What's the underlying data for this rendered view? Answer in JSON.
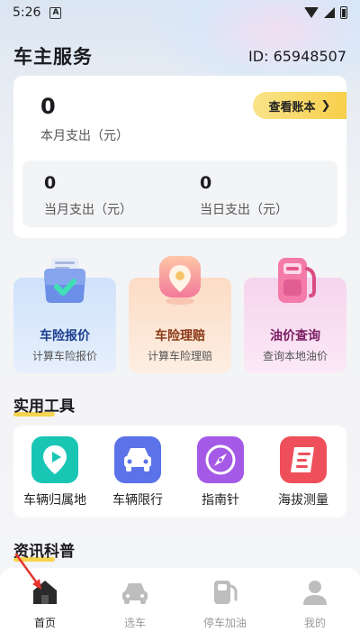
{
  "status_bar": {
    "time": "5:26",
    "a_icon": "A"
  },
  "header": {
    "title": "车主服务",
    "user_id": "ID: 65948507"
  },
  "summary": {
    "month_value": "0",
    "month_label": "本月支出（元）",
    "ledger_button": "查看账本",
    "current_month_value": "0",
    "current_month_label": "当月支出（元）",
    "today_value": "0",
    "today_label": "当日支出（元）"
  },
  "service_tiles": [
    {
      "title": "车险报价",
      "subtitle": "计算车险报价",
      "icon": "clipboard-check-icon"
    },
    {
      "title": "车险理赔",
      "subtitle": "计算车险理赔",
      "icon": "location-pin-icon"
    },
    {
      "title": "油价查询",
      "subtitle": "查询本地油价",
      "icon": "fuel-pump-icon"
    }
  ],
  "tools_section": {
    "title": "实用工具",
    "items": [
      {
        "label": "车辆归属地",
        "icon": "map-pin-icon",
        "color": "#19c6b4"
      },
      {
        "label": "车辆限行",
        "icon": "car-icon",
        "color": "#5b72e8"
      },
      {
        "label": "指南针",
        "icon": "compass-icon",
        "color": "#a45ae6"
      },
      {
        "label": "海拔测量",
        "icon": "altitude-icon",
        "color": "#ef4f5a"
      }
    ]
  },
  "news_section": {
    "title": "资讯科普"
  },
  "bottom_nav": [
    {
      "label": "首页",
      "icon": "home-icon",
      "active": true
    },
    {
      "label": "选车",
      "icon": "car-icon",
      "active": false
    },
    {
      "label": "停车加油",
      "icon": "gas-station-icon",
      "active": false
    },
    {
      "label": "我的",
      "icon": "person-icon",
      "active": false
    }
  ],
  "colors": {
    "accent_yellow": "#f7cf4b",
    "active_nav": "#222222",
    "inactive_nav": "#9a9a9a"
  }
}
